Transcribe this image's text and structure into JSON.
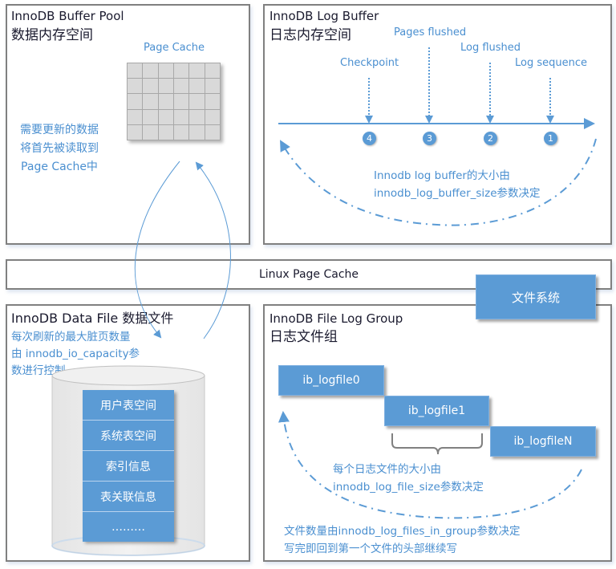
{
  "buffer_pool": {
    "title_en": "InnoDB Buffer Pool",
    "title_cn": "数据内存空间",
    "page_cache_label": "Page Cache",
    "grid": {
      "rows": 5,
      "cols": 6
    },
    "note_lines": [
      "需要更新的数据",
      "将首先被读取到",
      "Page Cache中"
    ]
  },
  "log_buffer": {
    "title_en": "InnoDB Log Buffer",
    "title_cn": "日志内存空间",
    "markers": [
      {
        "label": "Checkpoint",
        "number": "4"
      },
      {
        "label": "Pages flushed",
        "number": "3"
      },
      {
        "label": "Log flushed",
        "number": "2"
      },
      {
        "label": "Log sequence",
        "number": "1"
      }
    ],
    "note_lines": [
      "Innodb log buffer的大小由",
      "innodb_log_buffer_size参数决定"
    ]
  },
  "linux_page_cache": {
    "label": "Linux Page Cache"
  },
  "file_system": {
    "label": "文件系统"
  },
  "data_file": {
    "title": "InnoDB Data File 数据文件",
    "note_lines": [
      "每次刷新的最大脏页数量",
      "由 innodb_io_capacity参",
      "数进行控制"
    ],
    "segments": [
      "用户表空间",
      "系统表空间",
      "索引信息",
      "表关联信息",
      "………"
    ]
  },
  "log_group": {
    "title_en": "InnoDB File Log Group",
    "title_cn": "日志文件组",
    "files": [
      "ib_logfile0",
      "ib_logfile1",
      "ib_logfileN"
    ],
    "size_note_lines": [
      "每个日志文件的大小由",
      "innodb_log_file_size参数决定"
    ],
    "count_note_lines": [
      "文件数量由innodb_log_files_in_group参数决定",
      "写完即回到第一个文件的头部继续写"
    ]
  },
  "colors": {
    "accent": "#5b9bd5",
    "accent_text": "#4a8fd0",
    "border": "#808080",
    "grid_cell": "#d9d9d9"
  }
}
